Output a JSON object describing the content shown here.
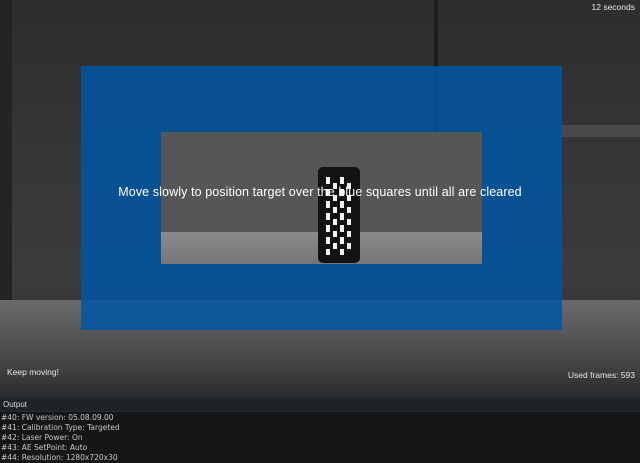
{
  "camera": {
    "timer": "12 seconds",
    "instruction": "Move slowly to position target over the blue squares until all are cleared",
    "status": "Keep moving!",
    "used_frames": "Used frames: 593",
    "overlay_color": "#0056A6"
  },
  "output": {
    "title": "Output",
    "lines": [
      "#40: FW version: 05.08.09.00",
      "#41: Calibration Type: Targeted",
      "#42: Laser Power: On",
      "#43: AE SetPoint: Auto",
      "#44: Resolution: 1280x720x30"
    ]
  }
}
